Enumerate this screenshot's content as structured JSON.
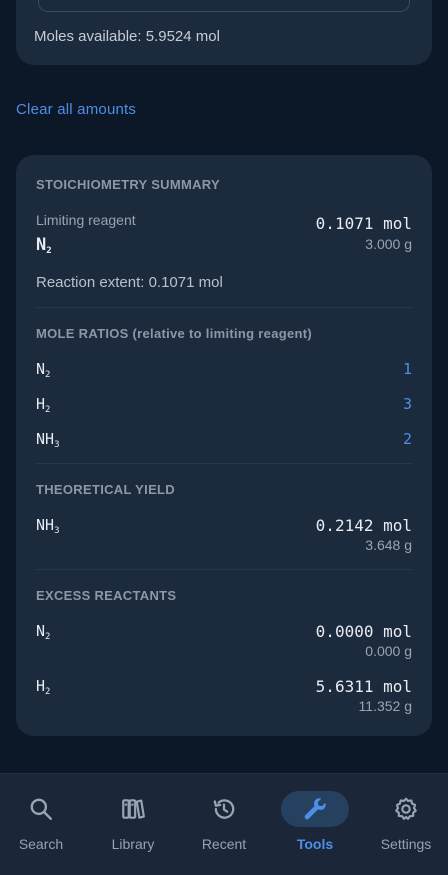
{
  "top_card": {
    "moles_available": "Moles available: 5.9524 mol"
  },
  "clear_all_label": "Clear all amounts",
  "summary": {
    "title": "STOICHIOMETRY SUMMARY",
    "limiting": {
      "label": "Limiting reagent",
      "formula_base": "N",
      "formula_sub": "2",
      "moles": "0.1071 mol",
      "grams": "3.000 g"
    },
    "reaction_extent": "Reaction extent: 0.1071 mol",
    "mole_ratios": {
      "title": "MOLE RATIOS (relative to limiting reagent)",
      "rows": [
        {
          "base": "N",
          "sub": "2",
          "value": "1"
        },
        {
          "base": "H",
          "sub": "2",
          "value": "3"
        },
        {
          "base": "NH",
          "sub": "3",
          "value": "2"
        }
      ]
    },
    "theoretical_yield": {
      "title": "THEORETICAL YIELD",
      "base": "NH",
      "sub": "3",
      "moles": "0.2142 mol",
      "grams": "3.648 g"
    },
    "excess": {
      "title": "EXCESS REACTANTS",
      "rows": [
        {
          "base": "N",
          "sub": "2",
          "moles": "0.0000 mol",
          "grams": "0.000 g"
        },
        {
          "base": "H",
          "sub": "2",
          "moles": "5.6311 mol",
          "grams": "11.352 g"
        }
      ]
    }
  },
  "nav": {
    "items": [
      {
        "label": "Search",
        "icon": "search-icon"
      },
      {
        "label": "Library",
        "icon": "library-icon"
      },
      {
        "label": "Recent",
        "icon": "history-icon"
      },
      {
        "label": "Tools",
        "icon": "wrench-icon"
      },
      {
        "label": "Settings",
        "icon": "gear-icon"
      }
    ],
    "active": "Tools",
    "accent_color": "#4d8fe6"
  }
}
